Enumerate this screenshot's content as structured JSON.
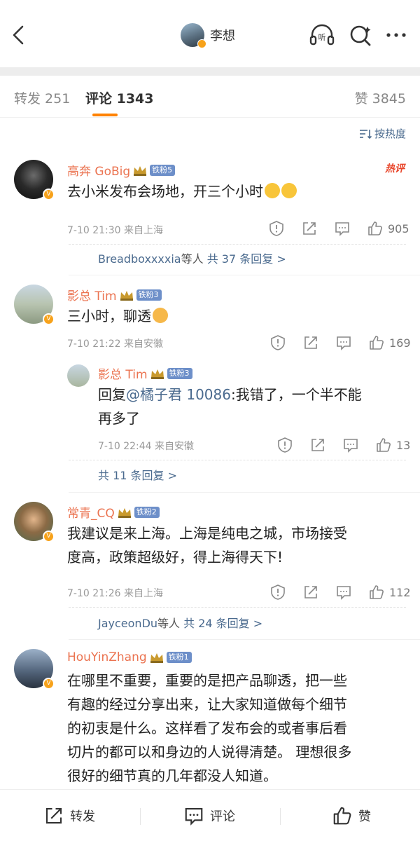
{
  "header": {
    "title": "李想"
  },
  "tabs": {
    "forward": "转发 251",
    "comment": "评论 1343",
    "like": "赞 3845"
  },
  "sort_label": "按热度",
  "hot_badge": "热评",
  "comments": [
    {
      "user": "高奔 GoBig",
      "fan_badge": "铁粉5",
      "text": "去小米发布会场地，开三个小时",
      "time": "7-10 21:30",
      "location": "来自上海",
      "likes": "905",
      "reply_users": "Breadboxxxxia",
      "reply_mid": "等人",
      "reply_count": "共 37 条回复 >"
    },
    {
      "user": "影总 Tim",
      "fan_badge": "铁粉3",
      "text": "三小时，聊透",
      "time": "7-10 21:22",
      "location": "来自安徽",
      "likes": "169",
      "reply": {
        "user": "影总 Tim",
        "fan_badge": "铁粉3",
        "prefix": "回复",
        "mention": "@橘子君 10086",
        "text_line1": ":我错了，一个半不能",
        "text_line2": "再多了",
        "time": "7-10 22:44",
        "location": "来自安徽",
        "likes": "13"
      },
      "reply_count": "共 11 条回复 >"
    },
    {
      "user": "常青_CQ",
      "fan_badge": "铁粉2",
      "text_line1": "我建议是来上海。上海是纯电之城，市场接受",
      "text_line2": "度高，政策超级好，得上海得天下!",
      "time": "7-10 21:26",
      "location": "来自上海",
      "likes": "112",
      "reply_users": "JayceonDu",
      "reply_mid": "等人",
      "reply_count": "共 24 条回复 >"
    },
    {
      "user": "HouYinZhang",
      "fan_badge": "铁粉1",
      "lines": [
        "在哪里不重要，重要的是把产品聊透，把一些",
        "有趣的经过分享出来，让大家知道做每个细节",
        "的初衷是什么。这样看了发布会的或者事后看",
        "切片的都可以和身边的人说得清楚。 理想很多",
        "很好的细节真的几年都没人知道。"
      ]
    }
  ],
  "bottom_bar": {
    "forward": "转发",
    "comment": "评论",
    "like": "赞"
  },
  "colors": {
    "username": "#eb7350",
    "link": "#4a6a8e",
    "tab_indicator": "#ff8200",
    "verified": "#f7a21b",
    "fan_badge": "#6d8fc9"
  },
  "icons": [
    "back-arrow-icon",
    "listen-icon",
    "search-icon",
    "more-icon",
    "sort-icon",
    "report-icon",
    "share-icon",
    "comment-icon",
    "like-icon",
    "crown-icon"
  ]
}
